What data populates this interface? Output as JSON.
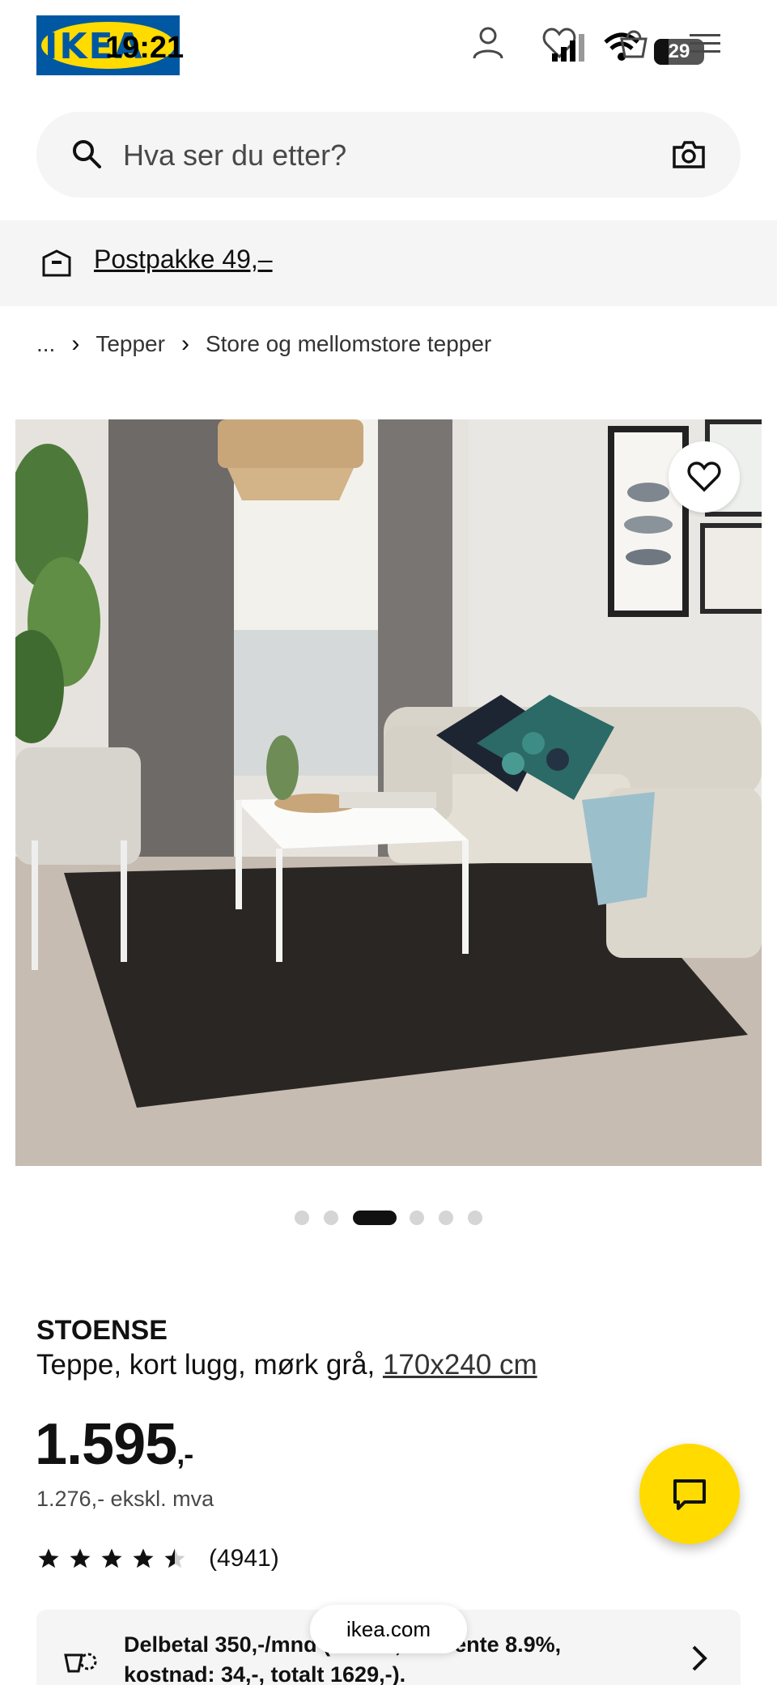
{
  "status_bar": {
    "time": "19:21",
    "battery": "29"
  },
  "brand": {
    "logo_text": "IKEA"
  },
  "search": {
    "placeholder": "Hva ser du etter?"
  },
  "delivery_banner": {
    "text": "Postpakke 49,–"
  },
  "breadcrumb": {
    "ellipsis": "...",
    "items": [
      "Tepper",
      "Store og mellomstore tepper"
    ]
  },
  "carousel": {
    "total_images": 6,
    "active_index": 2
  },
  "product": {
    "name": "STOENSE",
    "description": "Teppe, kort lugg, mørk grå, ",
    "size": "170x240 cm",
    "price": "1.595",
    "price_suffix": ",-",
    "price_ex_vat": "1.276,- ekskl. mva",
    "rating": 4.5,
    "rating_max": 5,
    "review_count": "(4941)"
  },
  "finance": {
    "line1": "Delbetal 350,-/mnd (5 mnd, eff. rente 8.9%,",
    "line2": "kostnad: 34,-, totalt 1629,-)."
  },
  "browser": {
    "url": "ikea.com"
  },
  "colors": {
    "brand_blue": "#0058a3",
    "brand_yellow": "#ffdb00"
  },
  "icons": [
    "person-icon",
    "heart-icon",
    "basket-icon",
    "menu-icon",
    "search-icon",
    "camera-icon",
    "delivery-box-icon",
    "chevron-right-icon",
    "chat-icon",
    "star-icon",
    "payment-icon"
  ]
}
